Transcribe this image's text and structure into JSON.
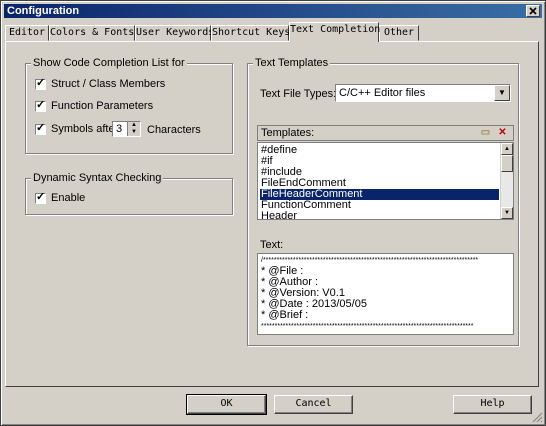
{
  "window": {
    "title": "Configuration"
  },
  "tabs": [
    {
      "label": "Editor"
    },
    {
      "label": "Colors & Fonts"
    },
    {
      "label": "User Keywords"
    },
    {
      "label": "Shortcut Keys"
    },
    {
      "label": "Text Completion",
      "active": true
    },
    {
      "label": "Other"
    }
  ],
  "code_completion": {
    "group_label": "Show Code Completion List for",
    "struct_label": "Struct / Class Members",
    "struct_checked": true,
    "params_label": "Function Parameters",
    "params_checked": true,
    "symbols_label": "Symbols after",
    "symbols_checked": true,
    "symbols_value": "3",
    "characters_label": "Characters"
  },
  "syntax_checking": {
    "group_label": "Dynamic Syntax Checking",
    "enable_label": "Enable",
    "enable_checked": true
  },
  "text_templates": {
    "group_label": "Text Templates",
    "file_types_label": "Text File Types:",
    "file_types_value": "C/C++ Editor files",
    "templates_label": "Templates:",
    "new_icon": "new-template-icon",
    "delete_icon": "delete-template-icon",
    "items": [
      "#define",
      "#if",
      "#include",
      "FileEndComment",
      "FileHeaderComment",
      "FunctionComment",
      "Header"
    ],
    "selected_index": 4,
    "text_label": "Text:",
    "text_lines": [
      "/*******************************************************************************",
      " * @File   :",
      " * @Author :",
      " * @Version: V0.1",
      " * @Date   : 2013/05/05",
      " * @Brief  :",
      " ******************************************************************************"
    ]
  },
  "buttons": {
    "ok": "OK",
    "cancel": "Cancel",
    "help": "Help"
  },
  "colors": {
    "title_bar": "#0a246a",
    "selection": "#0a246a",
    "face": "#d4d0c8"
  }
}
